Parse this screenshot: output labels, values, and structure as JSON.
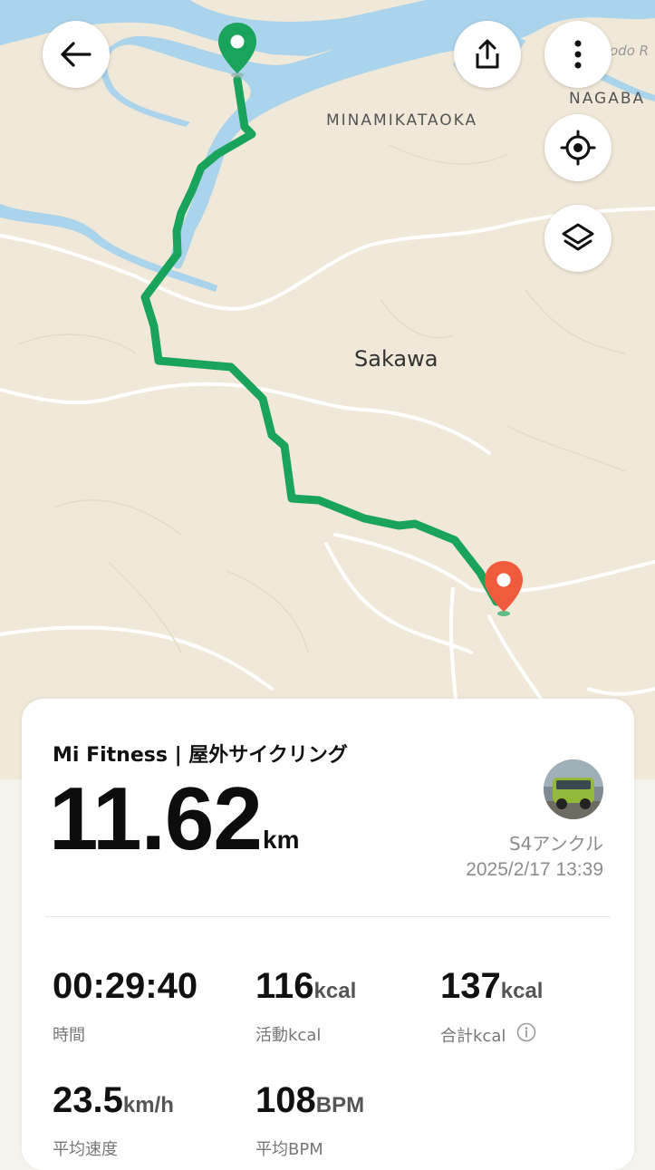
{
  "map": {
    "labels": {
      "minamikataoka": "MINAMIKATAOKA",
      "nagaba": "NAGABA",
      "sakawa": "Sakawa",
      "kodo": "odo R"
    },
    "colors": {
      "land": "#f0e8d8",
      "water": "#aad3ec",
      "road": "#ffffff",
      "route": "#1aa35a",
      "start_pin": "#1aa35a",
      "end_pin": "#ef5b3c"
    }
  },
  "toolbar": {
    "back_icon": "arrow-left-icon",
    "share_icon": "share-icon",
    "more_icon": "more-vertical-icon",
    "locate_icon": "locate-icon",
    "layers_icon": "layers-icon"
  },
  "summary": {
    "app_title": "Mi Fitness | 屋外サイクリング",
    "distance": "11.62",
    "distance_unit": "km",
    "device": "S4アンクル",
    "datetime": "2025/2/17 13:39"
  },
  "stats": [
    {
      "value": "00:29:40",
      "unit": "",
      "label": "時間"
    },
    {
      "value": "116",
      "unit": "kcal",
      "label": "活動kcal"
    },
    {
      "value": "137",
      "unit": "kcal",
      "label": "合計kcal"
    },
    {
      "value": "23.5",
      "unit": "km/h",
      "label": "平均速度"
    },
    {
      "value": "108",
      "unit": "BPM",
      "label": "平均BPM"
    }
  ]
}
